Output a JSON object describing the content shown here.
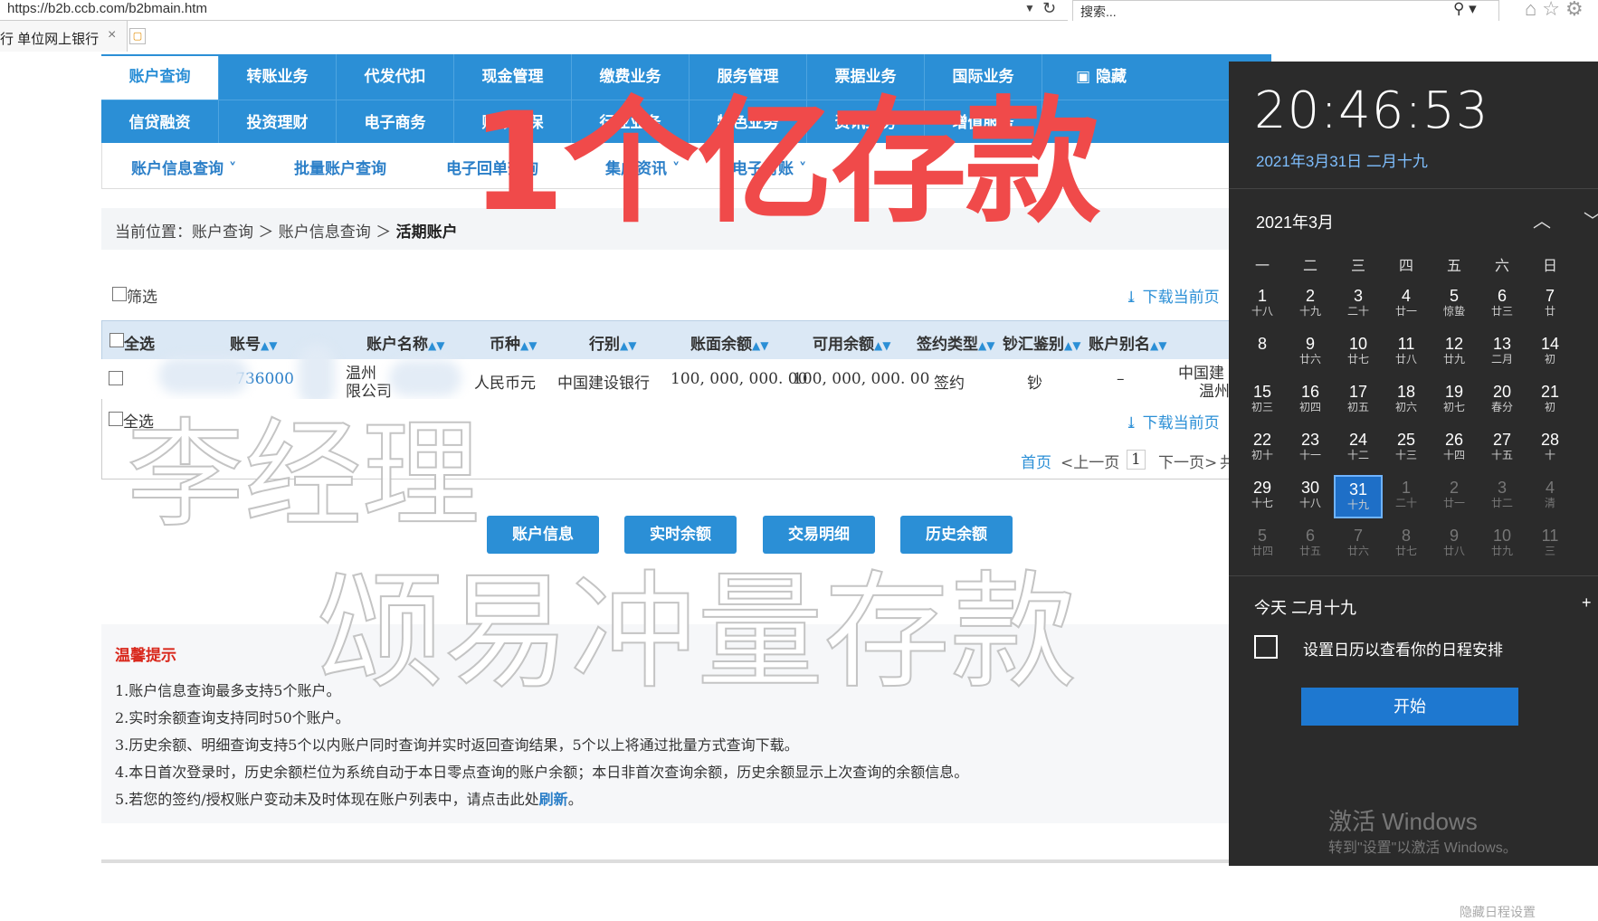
{
  "browser": {
    "url": "https://b2b.ccb.com/b2bmain.htm",
    "search_placeholder": "搜索...",
    "tab_title": "行 单位网上银行",
    "tab_close": "×"
  },
  "nav": {
    "row1": [
      "账户查询",
      "转账业务",
      "代发代扣",
      "现金管理",
      "缴费业务",
      "服务管理",
      "票据业务",
      "国际业务",
      "隐藏"
    ],
    "row2": [
      "信贷融资",
      "投资理财",
      "电子商务",
      "财政社保",
      "行业业务",
      "特色业务",
      "资讯业务",
      "增值服务"
    ],
    "sub": [
      "账户信息查询 ˅",
      "批量账户查询",
      "电子回单查询",
      "集成资讯 ˅",
      "电子对账 ˅"
    ]
  },
  "breadcrumb": {
    "prefix": "当前位置：账户查询 ＞ 账户信息查询 ＞ ",
    "current": "活期账户"
  },
  "toolbar": {
    "filter_label": "筛选",
    "download_label": "下载当前页"
  },
  "table": {
    "headers": [
      "全选",
      "账号",
      "账户名称",
      "币种",
      "行别",
      "账面余额",
      "可用余额",
      "签约类型",
      "钞汇鉴别",
      "账户别名"
    ],
    "row": {
      "account": "736000",
      "name_line1": "温州",
      "name_line2": "限公司",
      "currency": "人民币元",
      "bank": "中国建设银行",
      "book_balance": "100, 000, 000. 00",
      "available_balance": "100, 000, 000. 00",
      "sign_type": "签约",
      "cash_type": "钞",
      "alias": "–",
      "branch_line1": "中国建",
      "branch_line2": "温州"
    },
    "select_all_bottom": "全选"
  },
  "pagination": {
    "first": "首页",
    "prev": "<上一页",
    "page": "1",
    "next": "下一页>",
    "total": "共"
  },
  "buttons": [
    "账户信息",
    "实时余额",
    "交易明细",
    "历史余额"
  ],
  "tips": {
    "title": "温馨提示",
    "items": [
      "1.账户信息查询最多支持5个账户。",
      "2.实时余额查询支持同时50个账户。",
      "3.历史余额、明细查询支持5个以内账户同时查询并实时返回查询结果，5个以上将通过批量方式查询下载。",
      "4.本日首次登录时，历史余额栏位为系统自动于本日零点查询的账户余额；本日非首次查询余额，历史余额显示上次查询的余额信息。"
    ],
    "item5_prefix": "5.若您的签约/授权账户变动未及时体现在账户列表中，请点击此处",
    "item5_link": "刷新",
    "item5_suffix": "。"
  },
  "overlays": {
    "red_text": "1个亿存款",
    "white_text1": "李经理",
    "white_text2": "颂易冲量存款"
  },
  "calendar": {
    "time": "20:46:53",
    "date_line": "2021年3月31日 二月十九",
    "month": "2021年3月",
    "weekdays": [
      "一",
      "二",
      "三",
      "四",
      "五",
      "六",
      "日"
    ],
    "weeks": [
      [
        [
          "1",
          "十八"
        ],
        [
          "2",
          "十九"
        ],
        [
          "3",
          "二十"
        ],
        [
          "4",
          "廿一"
        ],
        [
          "5",
          "惊蛰"
        ],
        [
          "6",
          "廿三"
        ],
        [
          "7",
          "廿"
        ]
      ],
      [
        [
          "8",
          ""
        ],
        [
          "9",
          "廿六"
        ],
        [
          "10",
          "廿七"
        ],
        [
          "11",
          "廿八"
        ],
        [
          "12",
          "廿九"
        ],
        [
          "13",
          "二月"
        ],
        [
          "14",
          "初"
        ]
      ],
      [
        [
          "15",
          "初三"
        ],
        [
          "16",
          "初四"
        ],
        [
          "17",
          "初五"
        ],
        [
          "18",
          "初六"
        ],
        [
          "19",
          "初七"
        ],
        [
          "20",
          "春分"
        ],
        [
          "21",
          "初"
        ]
      ],
      [
        [
          "22",
          "初十"
        ],
        [
          "23",
          "十一"
        ],
        [
          "24",
          "十二"
        ],
        [
          "25",
          "十三"
        ],
        [
          "26",
          "十四"
        ],
        [
          "27",
          "十五"
        ],
        [
          "28",
          "十"
        ]
      ],
      [
        [
          "29",
          "十七"
        ],
        [
          "30",
          "十八"
        ],
        [
          "31",
          "十九"
        ],
        [
          "1",
          "二十"
        ],
        [
          "2",
          "廿一"
        ],
        [
          "3",
          "廿二"
        ],
        [
          "4",
          "清"
        ]
      ],
      [
        [
          "5",
          "廿四"
        ],
        [
          "6",
          "廿五"
        ],
        [
          "7",
          "廿六"
        ],
        [
          "8",
          "廿七"
        ],
        [
          "9",
          "廿八"
        ],
        [
          "10",
          "廿九"
        ],
        [
          "11",
          "三"
        ]
      ]
    ],
    "today_label": "今天 二月十九",
    "agenda_text": "设置日历以查看你的日程安排",
    "start_label": "开始",
    "activate_title": "激活 Windows",
    "activate_sub": "转到\"设置\"以激活 Windows。",
    "hide_link": "隐藏日程设置",
    "plus": "+"
  },
  "colors": {
    "nav_blue": "#2b8fd6",
    "tip_red": "#d9281c",
    "overlay_red": "#f04a4a",
    "flyout_bg": "#2b2b2b",
    "today_blue": "#1e6fc7"
  }
}
